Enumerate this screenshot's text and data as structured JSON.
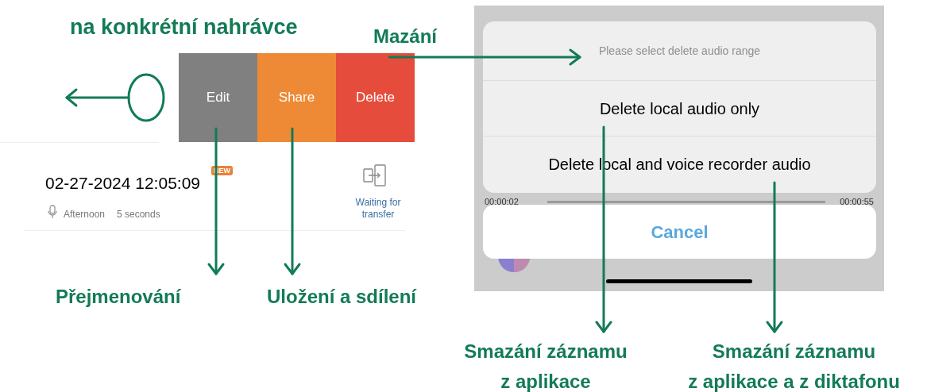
{
  "heading": "na konkrétní nahrávce",
  "swipe_actions": [
    {
      "label": "Edit",
      "color": "#808080"
    },
    {
      "label": "Share",
      "color": "#ee8a35"
    },
    {
      "label": "Delete",
      "color": "#e64c3c"
    }
  ],
  "recording": {
    "title": "02-27-2024 12:05:09",
    "badge": "NEW",
    "period": "Afternoon",
    "duration": "5 seconds",
    "transfer_status": "Waiting for transfer"
  },
  "delete_sheet": {
    "title": "Please select delete audio range",
    "options": [
      "Delete local audio only",
      "Delete local and voice recorder audio"
    ],
    "cancel": "Cancel"
  },
  "player": {
    "elapsed": "00:00:02",
    "total": "00:00:55"
  },
  "annotations": [
    {
      "kind": "delete",
      "text": "Mazání"
    },
    {
      "kind": "rename",
      "text": "Přejmenování"
    },
    {
      "kind": "share",
      "text": "Uložení a sdílení"
    },
    {
      "kind": "local",
      "lines": [
        "Smazání záznamu",
        "z aplikace"
      ]
    },
    {
      "kind": "both",
      "lines": [
        "Smazání záznamu",
        "z aplikace a z diktafonu"
      ]
    }
  ]
}
